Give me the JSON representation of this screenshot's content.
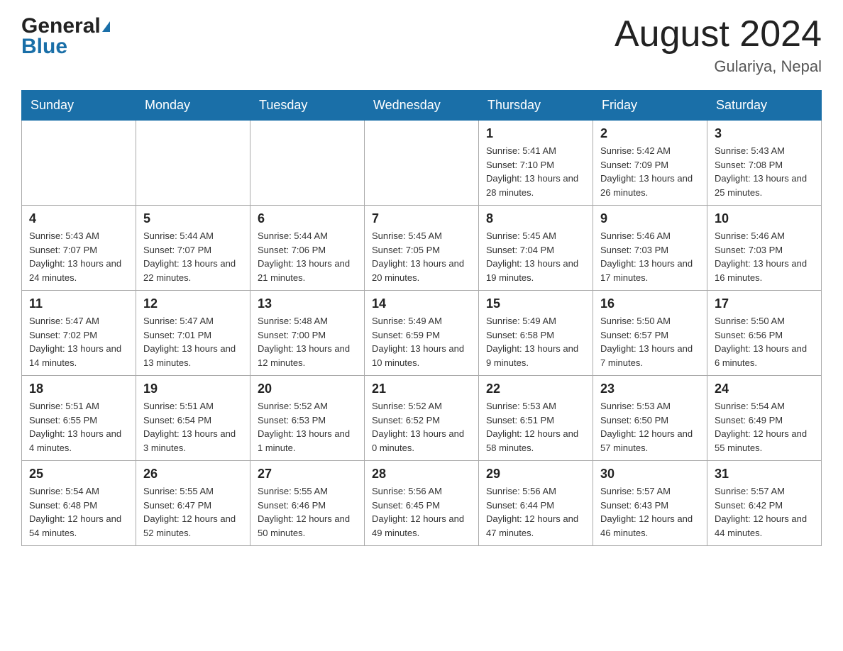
{
  "header": {
    "logo_general": "General",
    "logo_blue": "Blue",
    "title": "August 2024",
    "subtitle": "Gulariya, Nepal"
  },
  "days_of_week": [
    "Sunday",
    "Monday",
    "Tuesday",
    "Wednesday",
    "Thursday",
    "Friday",
    "Saturday"
  ],
  "weeks": [
    [
      {
        "day": "",
        "info": ""
      },
      {
        "day": "",
        "info": ""
      },
      {
        "day": "",
        "info": ""
      },
      {
        "day": "",
        "info": ""
      },
      {
        "day": "1",
        "info": "Sunrise: 5:41 AM\nSunset: 7:10 PM\nDaylight: 13 hours and 28 minutes."
      },
      {
        "day": "2",
        "info": "Sunrise: 5:42 AM\nSunset: 7:09 PM\nDaylight: 13 hours and 26 minutes."
      },
      {
        "day": "3",
        "info": "Sunrise: 5:43 AM\nSunset: 7:08 PM\nDaylight: 13 hours and 25 minutes."
      }
    ],
    [
      {
        "day": "4",
        "info": "Sunrise: 5:43 AM\nSunset: 7:07 PM\nDaylight: 13 hours and 24 minutes."
      },
      {
        "day": "5",
        "info": "Sunrise: 5:44 AM\nSunset: 7:07 PM\nDaylight: 13 hours and 22 minutes."
      },
      {
        "day": "6",
        "info": "Sunrise: 5:44 AM\nSunset: 7:06 PM\nDaylight: 13 hours and 21 minutes."
      },
      {
        "day": "7",
        "info": "Sunrise: 5:45 AM\nSunset: 7:05 PM\nDaylight: 13 hours and 20 minutes."
      },
      {
        "day": "8",
        "info": "Sunrise: 5:45 AM\nSunset: 7:04 PM\nDaylight: 13 hours and 19 minutes."
      },
      {
        "day": "9",
        "info": "Sunrise: 5:46 AM\nSunset: 7:03 PM\nDaylight: 13 hours and 17 minutes."
      },
      {
        "day": "10",
        "info": "Sunrise: 5:46 AM\nSunset: 7:03 PM\nDaylight: 13 hours and 16 minutes."
      }
    ],
    [
      {
        "day": "11",
        "info": "Sunrise: 5:47 AM\nSunset: 7:02 PM\nDaylight: 13 hours and 14 minutes."
      },
      {
        "day": "12",
        "info": "Sunrise: 5:47 AM\nSunset: 7:01 PM\nDaylight: 13 hours and 13 minutes."
      },
      {
        "day": "13",
        "info": "Sunrise: 5:48 AM\nSunset: 7:00 PM\nDaylight: 13 hours and 12 minutes."
      },
      {
        "day": "14",
        "info": "Sunrise: 5:49 AM\nSunset: 6:59 PM\nDaylight: 13 hours and 10 minutes."
      },
      {
        "day": "15",
        "info": "Sunrise: 5:49 AM\nSunset: 6:58 PM\nDaylight: 13 hours and 9 minutes."
      },
      {
        "day": "16",
        "info": "Sunrise: 5:50 AM\nSunset: 6:57 PM\nDaylight: 13 hours and 7 minutes."
      },
      {
        "day": "17",
        "info": "Sunrise: 5:50 AM\nSunset: 6:56 PM\nDaylight: 13 hours and 6 minutes."
      }
    ],
    [
      {
        "day": "18",
        "info": "Sunrise: 5:51 AM\nSunset: 6:55 PM\nDaylight: 13 hours and 4 minutes."
      },
      {
        "day": "19",
        "info": "Sunrise: 5:51 AM\nSunset: 6:54 PM\nDaylight: 13 hours and 3 minutes."
      },
      {
        "day": "20",
        "info": "Sunrise: 5:52 AM\nSunset: 6:53 PM\nDaylight: 13 hours and 1 minute."
      },
      {
        "day": "21",
        "info": "Sunrise: 5:52 AM\nSunset: 6:52 PM\nDaylight: 13 hours and 0 minutes."
      },
      {
        "day": "22",
        "info": "Sunrise: 5:53 AM\nSunset: 6:51 PM\nDaylight: 12 hours and 58 minutes."
      },
      {
        "day": "23",
        "info": "Sunrise: 5:53 AM\nSunset: 6:50 PM\nDaylight: 12 hours and 57 minutes."
      },
      {
        "day": "24",
        "info": "Sunrise: 5:54 AM\nSunset: 6:49 PM\nDaylight: 12 hours and 55 minutes."
      }
    ],
    [
      {
        "day": "25",
        "info": "Sunrise: 5:54 AM\nSunset: 6:48 PM\nDaylight: 12 hours and 54 minutes."
      },
      {
        "day": "26",
        "info": "Sunrise: 5:55 AM\nSunset: 6:47 PM\nDaylight: 12 hours and 52 minutes."
      },
      {
        "day": "27",
        "info": "Sunrise: 5:55 AM\nSunset: 6:46 PM\nDaylight: 12 hours and 50 minutes."
      },
      {
        "day": "28",
        "info": "Sunrise: 5:56 AM\nSunset: 6:45 PM\nDaylight: 12 hours and 49 minutes."
      },
      {
        "day": "29",
        "info": "Sunrise: 5:56 AM\nSunset: 6:44 PM\nDaylight: 12 hours and 47 minutes."
      },
      {
        "day": "30",
        "info": "Sunrise: 5:57 AM\nSunset: 6:43 PM\nDaylight: 12 hours and 46 minutes."
      },
      {
        "day": "31",
        "info": "Sunrise: 5:57 AM\nSunset: 6:42 PM\nDaylight: 12 hours and 44 minutes."
      }
    ]
  ]
}
